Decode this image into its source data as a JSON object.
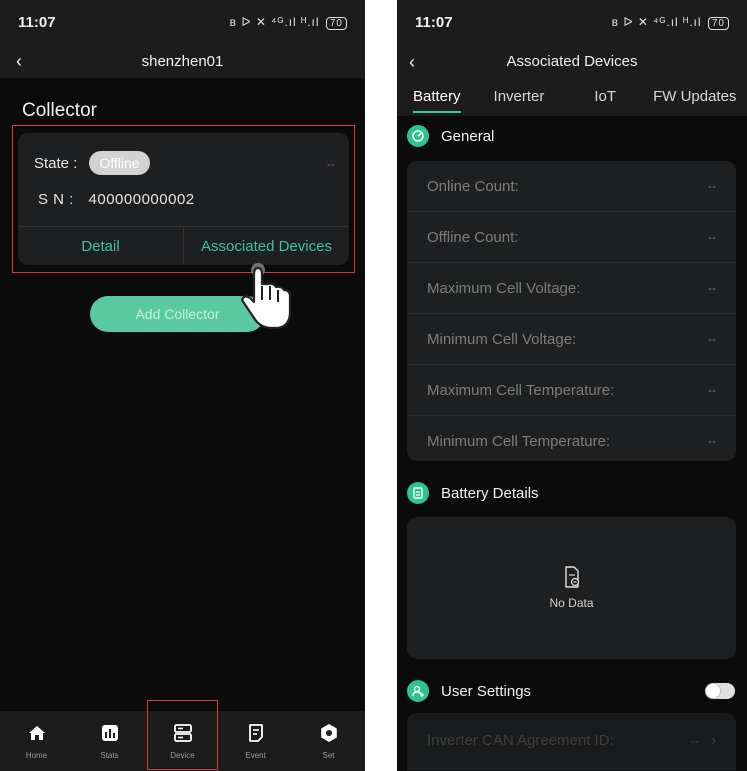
{
  "left": {
    "status": {
      "time": "11:07",
      "icons": "ʙ ᐅ ✕ ⁴ᴳ.ıl ᴴ.ıl",
      "battery": "70"
    },
    "header": {
      "back": "‹",
      "title": "shenzhen01"
    },
    "section_title": "Collector",
    "collector_card": {
      "state_label": "State :",
      "state_value": "Offline",
      "dash": "--",
      "sn_label": "S N :",
      "sn_value": "400000000002",
      "detail_label": "Detail",
      "associated_label": "Associated Devices"
    },
    "add_collector_label": "Add Collector",
    "nav": [
      {
        "label": "Home",
        "icon": "home-icon"
      },
      {
        "label": "Stats",
        "icon": "stats-icon"
      },
      {
        "label": "Device",
        "icon": "device-icon"
      },
      {
        "label": "Event",
        "icon": "event-icon"
      },
      {
        "label": "Set",
        "icon": "settings-icon"
      }
    ]
  },
  "right": {
    "status": {
      "time": "11:07",
      "icons": "ʙ ᐅ ✕ ⁴ᴳ.ıl ᴴ.ıl",
      "battery": "70"
    },
    "header": {
      "back": "‹",
      "title": "Associated Devices"
    },
    "tabs": [
      "Battery",
      "Inverter",
      "IoT",
      "FW Updates"
    ],
    "active_tab": "Battery",
    "general": {
      "title": "General",
      "rows": [
        {
          "label": "Online Count:",
          "value": "--"
        },
        {
          "label": "Offline Count:",
          "value": "--"
        },
        {
          "label": "Maximum Cell Voltage:",
          "value": "--"
        },
        {
          "label": "Minimum Cell Voltage:",
          "value": "--"
        },
        {
          "label": "Maximum Cell Temperature:",
          "value": "--"
        },
        {
          "label": "Minimum Cell Temperature:",
          "value": "--"
        }
      ]
    },
    "battery_details": {
      "title": "Battery Details",
      "empty_text": "No Data"
    },
    "user_settings": {
      "title": "User Settings",
      "toggle_on": false,
      "rows": [
        {
          "label": "Inverter CAN Agreement ID:",
          "value": "--",
          "chevron": "›"
        }
      ]
    }
  },
  "colors": {
    "accent": "#3cc59a",
    "highlight": "#d9363e",
    "background": "#0b0b0b",
    "card": "#1e1f20"
  }
}
